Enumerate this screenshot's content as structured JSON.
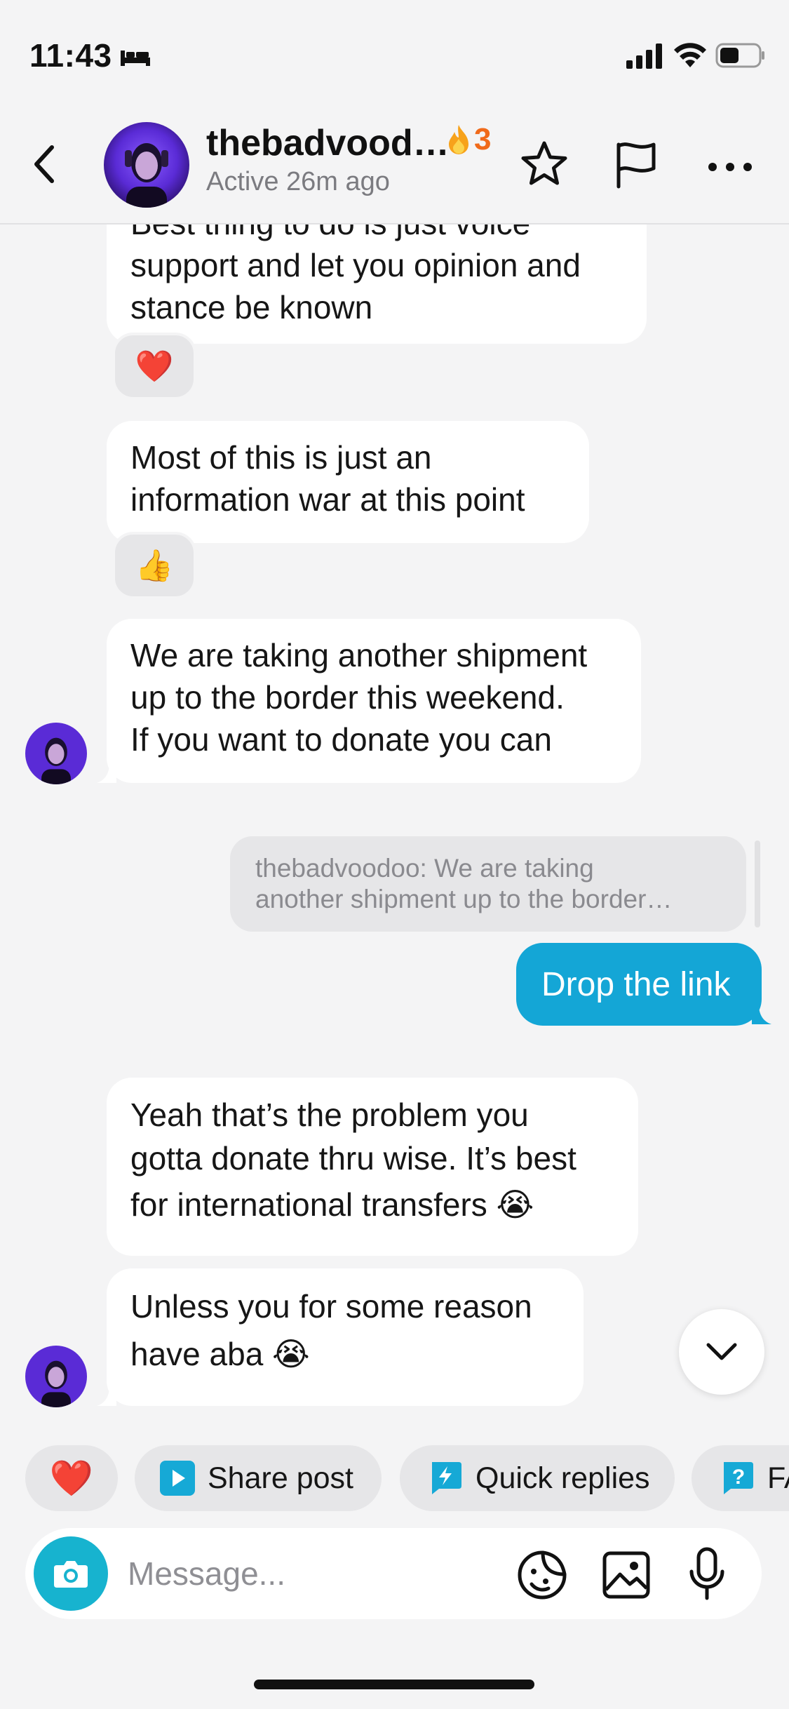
{
  "status_bar": {
    "time": "11:43"
  },
  "header": {
    "contact_name": "thebadvood…",
    "streak_count": "3",
    "active_status": "Active 26m ago"
  },
  "messages": [
    {
      "from": "contact",
      "lines": [
        "Best thing to do is just voice",
        "support and let you opinion and",
        "stance be known"
      ],
      "reaction": "❤️"
    },
    {
      "from": "contact",
      "lines": [
        "Most of this is just an",
        "information war at this point"
      ],
      "reaction": "👍"
    },
    {
      "from": "contact",
      "lines": [
        "We are taking another shipment",
        "up to the border this weekend.",
        "If you want to donate you can"
      ]
    },
    {
      "from": "me",
      "reply_to_lines": [
        "thebadvoodoo: We are taking",
        "another shipment up to the border…"
      ],
      "text": "Drop the link"
    },
    {
      "from": "contact",
      "lines": [
        "Yeah that’s the problem you",
        "gotta donate thru wise. It’s best",
        "for international transfers 😭"
      ]
    },
    {
      "from": "contact",
      "lines": [
        "Unless you for some reason",
        "have aba 😭"
      ]
    }
  ],
  "quick_actions": {
    "heart": "❤️",
    "share_post": "Share post",
    "quick_replies": "Quick replies",
    "faq": "FAQ"
  },
  "composer": {
    "placeholder": "Message..."
  },
  "colors": {
    "sent_bubble": "#14a6d6",
    "camera_button": "#17b3cf",
    "streak": "#f06a1a",
    "background": "#f4f4f5"
  },
  "icons": [
    "bed-icon",
    "signal-icon",
    "wifi-icon",
    "battery-icon",
    "back-icon",
    "flame-icon",
    "star-icon",
    "flag-icon",
    "more-icon",
    "chevron-down-icon",
    "play-icon",
    "lightning-icon",
    "question-icon",
    "camera-icon",
    "sticker-icon",
    "image-icon",
    "mic-icon"
  ]
}
